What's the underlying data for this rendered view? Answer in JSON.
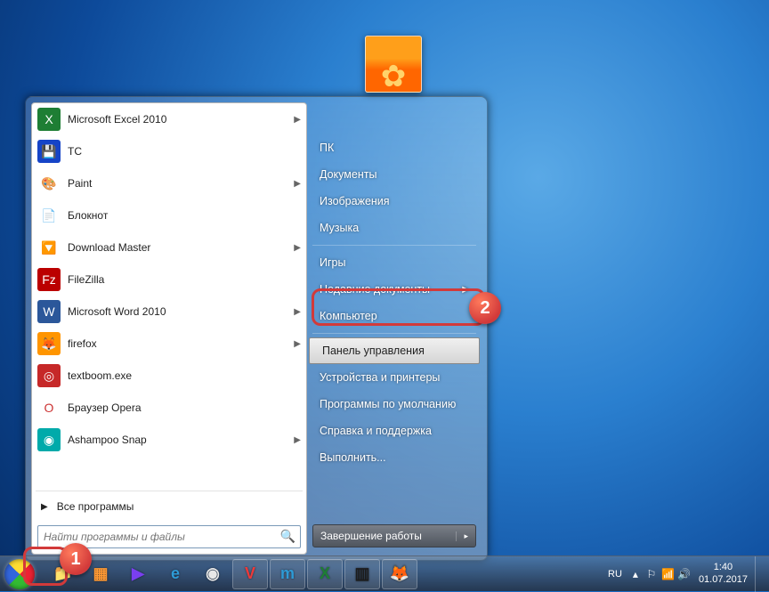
{
  "user_picture_alt": "Цветок",
  "programs": [
    {
      "label": "Microsoft Excel 2010",
      "icon_bg": "#1e7e34",
      "icon_glyph": "X",
      "has_submenu": true
    },
    {
      "label": "TC",
      "icon_bg": "#1644c7",
      "icon_glyph": "💾",
      "has_submenu": false
    },
    {
      "label": "Paint",
      "icon_bg": "#fff",
      "icon_glyph": "🎨",
      "has_submenu": true
    },
    {
      "label": "Блокнот",
      "icon_bg": "#fff",
      "icon_glyph": "📄",
      "has_submenu": false
    },
    {
      "label": "Download Master",
      "icon_bg": "#fff",
      "icon_glyph": "🔽",
      "has_submenu": true
    },
    {
      "label": "FileZilla",
      "icon_bg": "#b00",
      "icon_glyph": "Fz",
      "has_submenu": false
    },
    {
      "label": "Microsoft Word 2010",
      "icon_bg": "#2b579a",
      "icon_glyph": "W",
      "has_submenu": true
    },
    {
      "label": "firefox",
      "icon_bg": "#ff9500",
      "icon_glyph": "🦊",
      "has_submenu": true
    },
    {
      "label": "textboom.exe",
      "icon_bg": "#c62828",
      "icon_glyph": "◎",
      "has_submenu": false
    },
    {
      "label": "Браузер Opera",
      "icon_bg": "#fff",
      "icon_glyph": "O",
      "has_submenu": false
    },
    {
      "label": "Ashampoo Snap",
      "icon_bg": "#0aa",
      "icon_glyph": "◉",
      "has_submenu": true
    }
  ],
  "all_programs_label": "Все программы",
  "search_placeholder": "Найти программы и файлы",
  "right_panel": {
    "user": "ПК",
    "items_top": [
      {
        "label": "Документы"
      },
      {
        "label": "Изображения"
      },
      {
        "label": "Музыка"
      }
    ],
    "items_mid": [
      {
        "label": "Игры"
      },
      {
        "label": "Недавние документы",
        "has_submenu": true
      },
      {
        "label": "Компьютер"
      }
    ],
    "items_bot": [
      {
        "label": "Панель управления",
        "highlighted": true
      },
      {
        "label": "Устройства и принтеры"
      },
      {
        "label": "Программы по умолчанию"
      },
      {
        "label": "Справка и поддержка"
      },
      {
        "label": "Выполнить..."
      }
    ]
  },
  "shutdown_label": "Завершение работы",
  "callouts": {
    "one": "1",
    "two": "2"
  },
  "taskbar": {
    "pinned": [
      {
        "name": "explorer",
        "glyph": "📁",
        "color": "#f3c14b"
      },
      {
        "name": "wmplayer",
        "glyph": "▦",
        "color": "#ff9933"
      },
      {
        "name": "media",
        "glyph": "▶",
        "color": "#7a3ff0"
      },
      {
        "name": "ie",
        "glyph": "e",
        "color": "#2e9bd6"
      },
      {
        "name": "chrome",
        "glyph": "◉",
        "color": "#e8e8e8"
      },
      {
        "name": "vivaldi",
        "glyph": "V",
        "color": "#ef3939",
        "running": true
      },
      {
        "name": "maxthon",
        "glyph": "m",
        "color": "#2e9bd6",
        "running": true
      },
      {
        "name": "excel",
        "glyph": "X",
        "color": "#1e7e34",
        "running": true
      },
      {
        "name": "terminal",
        "glyph": "▥",
        "color": "#1c1c1c",
        "running": true
      },
      {
        "name": "firefox",
        "glyph": "🦊",
        "color": "#ff9500",
        "running": true
      }
    ],
    "lang": "RU",
    "time": "1:40",
    "date": "01.07.2017"
  }
}
